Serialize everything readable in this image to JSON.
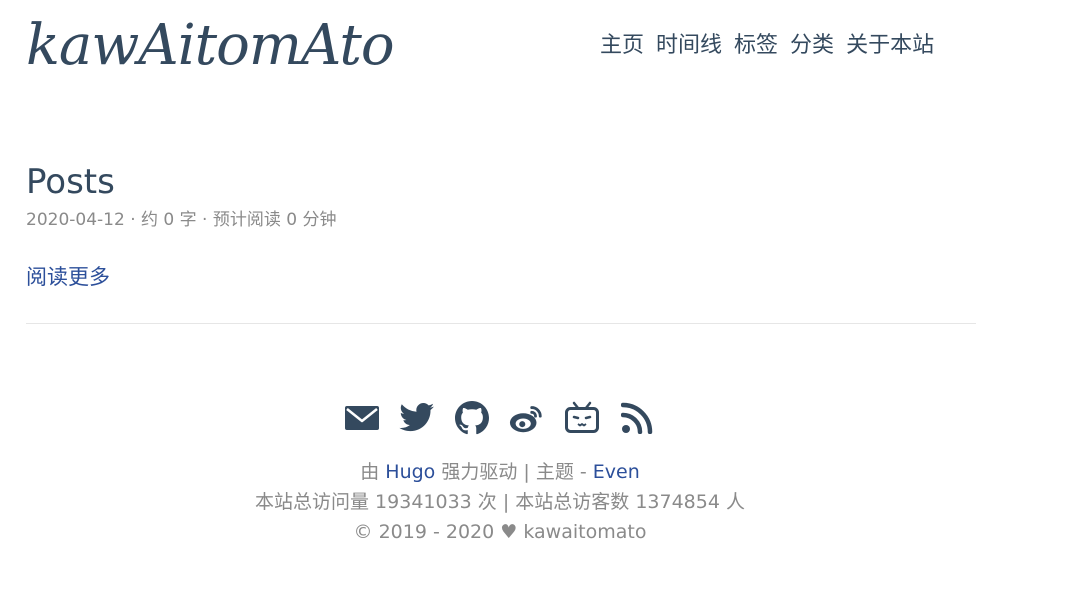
{
  "site": {
    "logo": "kawAitomAto"
  },
  "nav": {
    "items": [
      {
        "label": "主页"
      },
      {
        "label": "时间线"
      },
      {
        "label": "标签"
      },
      {
        "label": "分类"
      },
      {
        "label": "关于本站"
      }
    ]
  },
  "post": {
    "title": "Posts",
    "meta": "2020-04-12 · 约 0 字 · 预计阅读 0 分钟",
    "read_more": "阅读更多"
  },
  "footer": {
    "social": [
      "email-icon",
      "twitter-icon",
      "github-icon",
      "weibo-icon",
      "bilibili-icon",
      "rss-icon"
    ],
    "powered_prefix": "由",
    "powered_link": "Hugo",
    "powered_suffix": "强力驱动 | 主题 -",
    "theme_link": "Even",
    "stats": "本站总访问量 19341033 次 | 本站总访客数 1374854 人",
    "copyright_years": "© 2019 - 2020",
    "copyright_heart": "♥",
    "copyright_name": "kawaitomato"
  },
  "colors": {
    "text": "#34495e",
    "muted": "#8a8a8a",
    "link": "#2c4f9a",
    "divider": "#e6e6e6"
  }
}
